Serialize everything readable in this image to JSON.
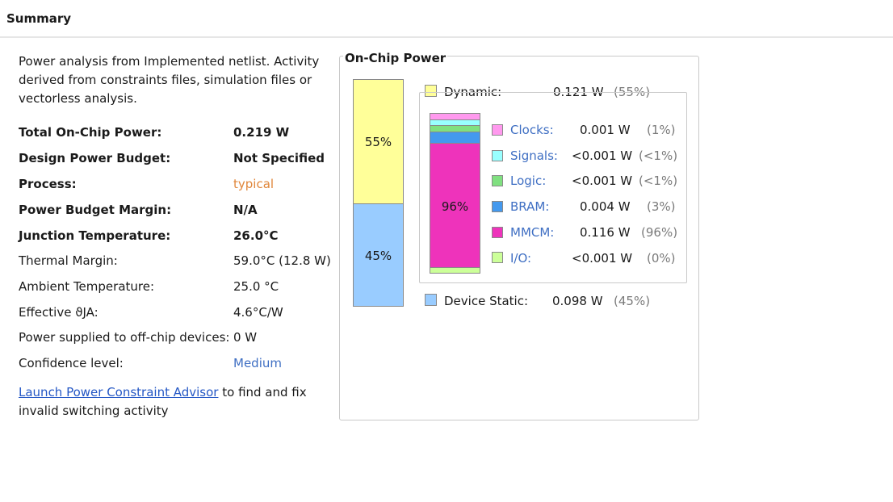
{
  "header": {
    "title": "Summary"
  },
  "intro": "Power analysis from Implemented netlist. Activity derived from constraints files, simulation files or vectorless analysis.",
  "rows": [
    {
      "label": "Total On-Chip Power:",
      "value": "0.219 W"
    },
    {
      "label": "Design Power Budget:",
      "value": "Not Specified"
    },
    {
      "label": "Process:",
      "value": "typical"
    },
    {
      "label": "Power Budget Margin:",
      "value": "N/A"
    },
    {
      "label": "Junction Temperature:",
      "value": "26.0°C"
    },
    {
      "label": "Thermal Margin:",
      "value": "59.0°C (12.8 W)"
    },
    {
      "label": "Ambient Temperature:",
      "value": "25.0 °C"
    },
    {
      "label": "Effective ϑJA:",
      "value": "4.6°C/W"
    },
    {
      "label": "Power supplied to off-chip devices:",
      "value": "0 W"
    },
    {
      "label": "Confidence level:",
      "value": "Medium"
    }
  ],
  "footer": {
    "link": "Launch Power Constraint Advisor",
    "rest": " to find and fix invalid switching activity"
  },
  "onchip": {
    "title": "On-Chip Power",
    "dynamic": {
      "label": "Dynamic:",
      "value": "0.121 W",
      "pct": "(55%)",
      "bar_pct": "55%",
      "color": "#ffff99"
    },
    "static": {
      "label": "Device Static:",
      "value": "0.098 W",
      "pct": "(45%)",
      "bar_pct": "45%",
      "color": "#99ccff"
    },
    "inner_bar_pct": "96%",
    "items": [
      {
        "label": "Clocks:",
        "value": "0.001 W",
        "pct": "(1%)",
        "color": "#ff99ee"
      },
      {
        "label": "Signals:",
        "value": "<0.001 W",
        "pct": "(<1%)",
        "color": "#99ffff"
      },
      {
        "label": "Logic:",
        "value": "<0.001 W",
        "pct": "(<1%)",
        "color": "#80e080"
      },
      {
        "label": "BRAM:",
        "value": "0.004 W",
        "pct": "(3%)",
        "color": "#4499ee"
      },
      {
        "label": "MMCM:",
        "value": "0.116 W",
        "pct": "(96%)",
        "color": "#ee33bb"
      },
      {
        "label": "I/O:",
        "value": "<0.001 W",
        "pct": "(0%)",
        "color": "#ccff99"
      }
    ]
  }
}
